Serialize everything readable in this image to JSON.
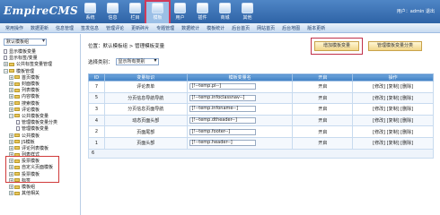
{
  "app": {
    "logo": "EmpireCMS"
  },
  "topnav": [
    {
      "label": "系统"
    },
    {
      "label": "信息"
    },
    {
      "label": "栏目"
    },
    {
      "label": "模板"
    },
    {
      "label": "用户"
    },
    {
      "label": "插件"
    },
    {
      "label": "商城"
    },
    {
      "label": "其他"
    }
  ],
  "user_info": "用户：admin  退出",
  "subnav": [
    "常用操作",
    "数据更新",
    "信息管理",
    "签发信息",
    "管理评论",
    "更新碎片",
    "专题管理",
    "数据统计",
    "模板统计",
    "后台首页",
    "网站首页",
    "后台地图",
    "版本更新"
  ],
  "sidebar": {
    "template_group": "默认模板组",
    "tree": [
      {
        "label": "显示模板变量",
        "kind": "doc",
        "prefix": "□"
      },
      {
        "label": "显示标签/变量",
        "kind": "doc",
        "prefix": "□"
      },
      {
        "label": "公共标签变量管理",
        "kind": "folder",
        "prefix": "+"
      },
      {
        "label": "模板管理",
        "kind": "folder",
        "prefix": "−"
      },
      {
        "label": "首页模板",
        "kind": "folder",
        "prefix": "+"
      },
      {
        "label": "封面模板",
        "kind": "folder",
        "prefix": "+"
      },
      {
        "label": "列表模板",
        "kind": "folder",
        "prefix": "+"
      },
      {
        "label": "内容模板",
        "kind": "folder",
        "prefix": "+"
      },
      {
        "label": "搜索模板",
        "kind": "folder",
        "prefix": "+"
      },
      {
        "label": "评论模板",
        "kind": "folder",
        "prefix": "+"
      },
      {
        "label": "公共模板变量",
        "kind": "folder",
        "prefix": "−"
      },
      {
        "label": "管理模板变量分类",
        "kind": "doc",
        "prefix": ""
      },
      {
        "label": "管理模板变量",
        "kind": "doc",
        "prefix": ""
      },
      {
        "label": "公共模板",
        "kind": "folder",
        "prefix": "+"
      },
      {
        "label": "JS模板",
        "kind": "folder",
        "prefix": "+"
      },
      {
        "label": "评论列表模板",
        "kind": "folder",
        "prefix": "+"
      },
      {
        "label": "列表样式",
        "kind": "folder",
        "prefix": "+"
      },
      {
        "label": "投票模板",
        "kind": "folder",
        "prefix": "+"
      },
      {
        "label": "自定义页面模板",
        "kind": "folder",
        "prefix": "+"
      },
      {
        "label": "投票模板",
        "kind": "folder",
        "prefix": "+"
      },
      {
        "label": "标签",
        "kind": "folder",
        "prefix": "+"
      },
      {
        "label": "模板组",
        "kind": "folder",
        "prefix": "+"
      },
      {
        "label": "其他相关",
        "kind": "folder",
        "prefix": "+"
      }
    ]
  },
  "main": {
    "breadcrumb": "位置：默认模板组 > 管理模板变量",
    "filter_label": "选择类别：",
    "filter_value": "显示所有类别",
    "add_button": "增加模板变量",
    "category_button": "管理模板变量分类",
    "table": {
      "headers": [
        "ID",
        "变量标识",
        "模板变量名",
        "开启",
        "操作"
      ],
      "rows": [
        {
          "id": "7",
          "name": "评论表单",
          "var": "[!--temp.pl--]",
          "enabled": "开启",
          "ops": "[修改] [复制] [删除]"
        },
        {
          "id": "5",
          "name": "分页信息导航导航",
          "var": "[!--temp.infoclassnav--]",
          "enabled": "开启",
          "ops": "[修改] [复制] [删除]"
        },
        {
          "id": "3",
          "name": "分页信息页面导航",
          "var": "[!--temp.infoname--]",
          "enabled": "开启",
          "ops": "[修改] [复制] [删除]"
        },
        {
          "id": "4",
          "name": "动态页面头部",
          "var": "[!--temp.dtheader--]",
          "enabled": "开启",
          "ops": "[修改] [复制] [删除]"
        },
        {
          "id": "2",
          "name": "页面尾部",
          "var": "[!--temp.footer--]",
          "enabled": "开启",
          "ops": "[修改] [复制] [删除]"
        },
        {
          "id": "1",
          "name": "页面头部",
          "var": "[!--temp.header--]",
          "enabled": "开启",
          "ops": "[修改] [复制] [删除]"
        }
      ],
      "footer": "6"
    }
  }
}
